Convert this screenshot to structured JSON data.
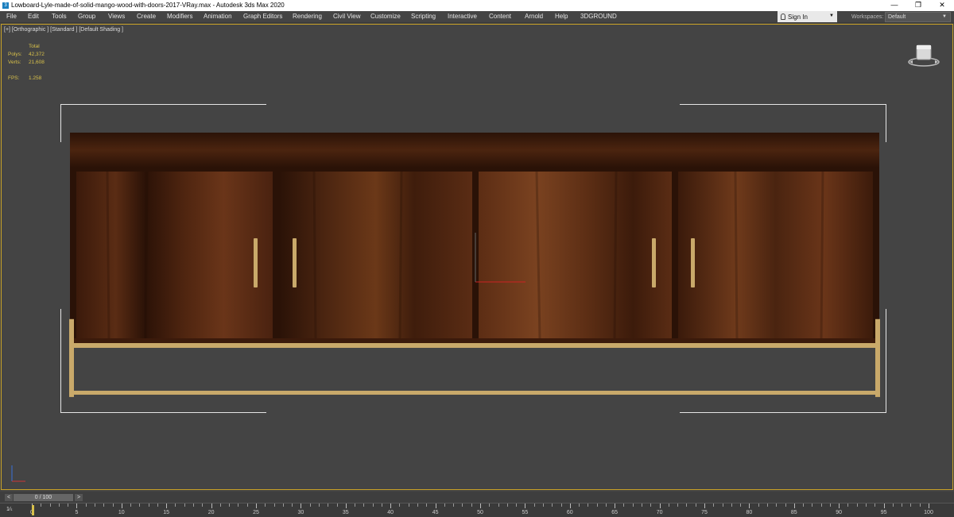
{
  "window": {
    "title": "Lowboard-Lyle-made-of-solid-mango-wood-with-doors-2017-VRay.max - Autodesk 3ds Max 2020",
    "minimize_glyph": "—",
    "restore_glyph": "❐",
    "close_glyph": "✕"
  },
  "menu": [
    "File",
    "Edit",
    "Tools",
    "Group",
    "Views",
    "Create",
    "Modifiers",
    "Animation",
    "Graph Editors",
    "Rendering",
    "Civil View",
    "Customize",
    "Scripting",
    "Interactive",
    "Content",
    "Arnold",
    "Help",
    "3DGROUND"
  ],
  "signin": {
    "label": "Sign In",
    "caret": "▼"
  },
  "workspaces": {
    "label": "Workspaces:",
    "value": "Default",
    "caret": "▼"
  },
  "viewport": {
    "label": "[+] [Orthographic ] [Standard ] [Default Shading ]",
    "stats": {
      "header": "Total",
      "polys_label": "Polys:",
      "polys_value": "42,372",
      "verts_label": "Verts:",
      "verts_value": "21,608",
      "fps_label": "FPS:",
      "fps_value": "1.258"
    }
  },
  "timeline": {
    "prev": "<",
    "frame_display": "0 / 100",
    "next": ">"
  },
  "trackbar": {
    "mode_icon": "1⁄ₛ",
    "ticks": [
      "0",
      "5",
      "10",
      "15",
      "20",
      "25",
      "30",
      "35",
      "40",
      "45",
      "50",
      "55",
      "60",
      "65",
      "70",
      "75",
      "80",
      "85",
      "90",
      "95",
      "100"
    ]
  },
  "colors": {
    "wood_dark": "#3a1c0c",
    "wood_mid": "#5a2e16",
    "brass": "#c9a96a",
    "accent": "#c9a227",
    "stats_text": "#d8c04a"
  }
}
